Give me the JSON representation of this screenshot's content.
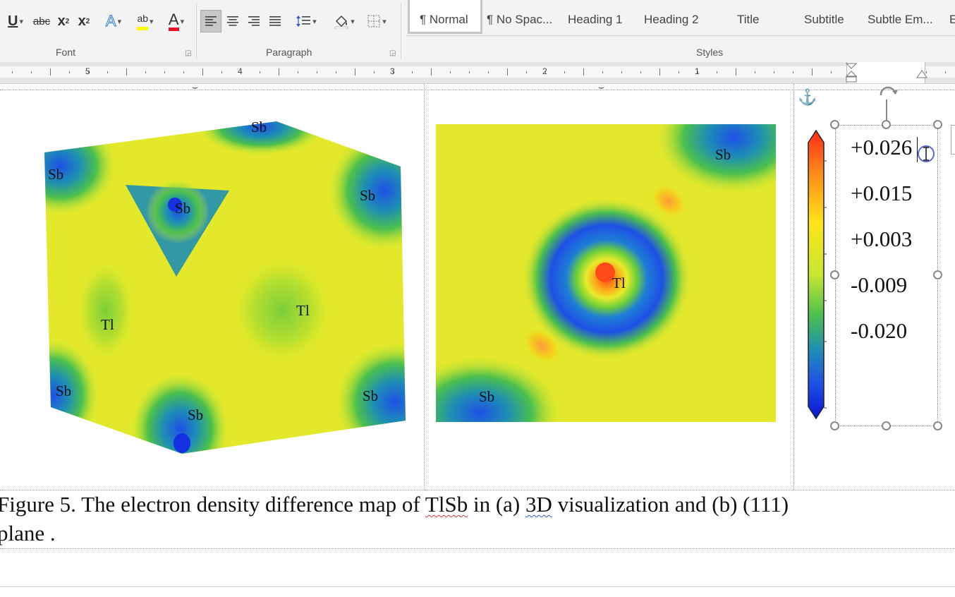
{
  "ribbon": {
    "font_group": {
      "label": "Font",
      "buttons": {
        "underline": "U",
        "strikethrough": "abc",
        "subscript": "x",
        "subscript_mark": "2",
        "superscript": "x",
        "superscript_mark": "2",
        "text_effects": "A",
        "highlight": "ab",
        "font_color": "A"
      },
      "colors": {
        "highlight": "#ffff00",
        "font_color": "#e81123",
        "text_effects": "#2b7cd3"
      }
    },
    "paragraph_group": {
      "label": "Paragraph"
    },
    "styles_group": {
      "label": "Styles",
      "items": [
        {
          "label": "¶ Normal",
          "selected": true
        },
        {
          "label": "¶ No Spac..."
        },
        {
          "label": "Heading 1"
        },
        {
          "label": "Heading 2"
        },
        {
          "label": "Title"
        },
        {
          "label": "Subtitle"
        },
        {
          "label": "Subtle Em..."
        }
      ]
    }
  },
  "ruler": {
    "numbers": [
      "5",
      "4",
      "3",
      "2",
      "1"
    ]
  },
  "figure": {
    "panel_a": {
      "atoms": [
        {
          "label": "Sb"
        },
        {
          "label": "Sb"
        },
        {
          "label": "Sb"
        },
        {
          "label": "Sb"
        },
        {
          "label": "Tl"
        },
        {
          "label": "Tl"
        },
        {
          "label": "Sb"
        },
        {
          "label": "Sb"
        },
        {
          "label": "Sb"
        }
      ]
    },
    "panel_b": {
      "atoms": [
        {
          "label": "Sb"
        },
        {
          "label": "Tl"
        },
        {
          "label": "Sb"
        }
      ]
    },
    "colorbar": {
      "labels": [
        "+0.026",
        "+0.015",
        "+0.003",
        "-0.009",
        "-0.020"
      ],
      "gradient": [
        "#ff2a1a",
        "#ff8c1a",
        "#ffe41a",
        "#c8e632",
        "#4cc04c",
        "#1e8fb4",
        "#1e50e6",
        "#0a14d2"
      ]
    },
    "caption": {
      "text_1": "Figure 5. The electron density difference map of ",
      "flagged_word": "TlSb",
      "text_2": " in (a) ",
      "flagged_word_2": " 3D",
      "text_3": " visualization and (b) (111)",
      "text_line_2": "plane ."
    }
  }
}
